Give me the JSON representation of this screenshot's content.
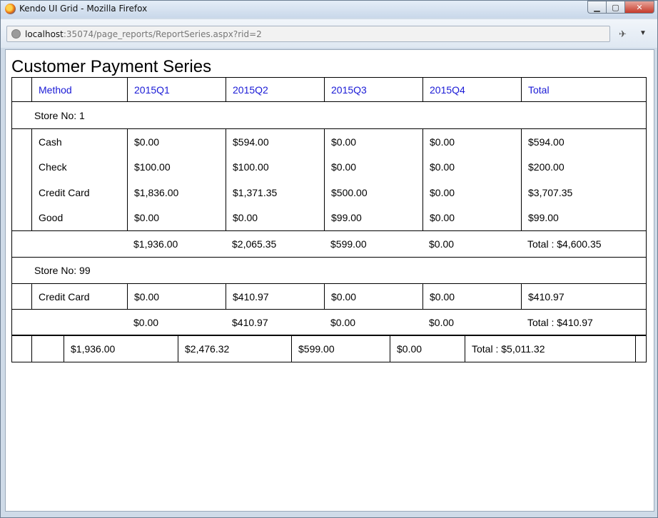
{
  "browser": {
    "window_title": "Kendo UI Grid - Mozilla Firefox",
    "url_host": "localhost",
    "url_rest": ":35074/page_reports/ReportSeries.aspx?rid=2"
  },
  "page": {
    "title": "Customer Payment Series"
  },
  "grid": {
    "columns": [
      "Method",
      "2015Q1",
      "2015Q2",
      "2015Q3",
      "2015Q4",
      "Total"
    ],
    "groups": [
      {
        "label": "Store No: 1",
        "rows": [
          [
            "Cash",
            "$0.00",
            "$594.00",
            "$0.00",
            "$0.00",
            "$594.00"
          ],
          [
            "Check",
            "$100.00",
            "$100.00",
            "$0.00",
            "$0.00",
            "$200.00"
          ],
          [
            "Credit Card",
            "$1,836.00",
            "$1,371.35",
            "$500.00",
            "$0.00",
            "$3,707.35"
          ],
          [
            "Good",
            "$0.00",
            "$0.00",
            "$99.00",
            "$0.00",
            "$99.00"
          ]
        ],
        "footer": [
          "$1,936.00",
          "$2,065.35",
          "$599.00",
          "$0.00",
          "Total : $4,600.35"
        ]
      },
      {
        "label": "Store No: 99",
        "rows": [
          [
            "Credit Card",
            "$0.00",
            "$410.97",
            "$0.00",
            "$0.00",
            "$410.97"
          ]
        ],
        "footer": [
          "$0.00",
          "$410.97",
          "$0.00",
          "$0.00",
          "Total : $410.97"
        ]
      }
    ],
    "grand_total": [
      "$1,936.00",
      "$2,476.32",
      "$599.00",
      "$0.00",
      "Total : $5,011.32"
    ]
  }
}
